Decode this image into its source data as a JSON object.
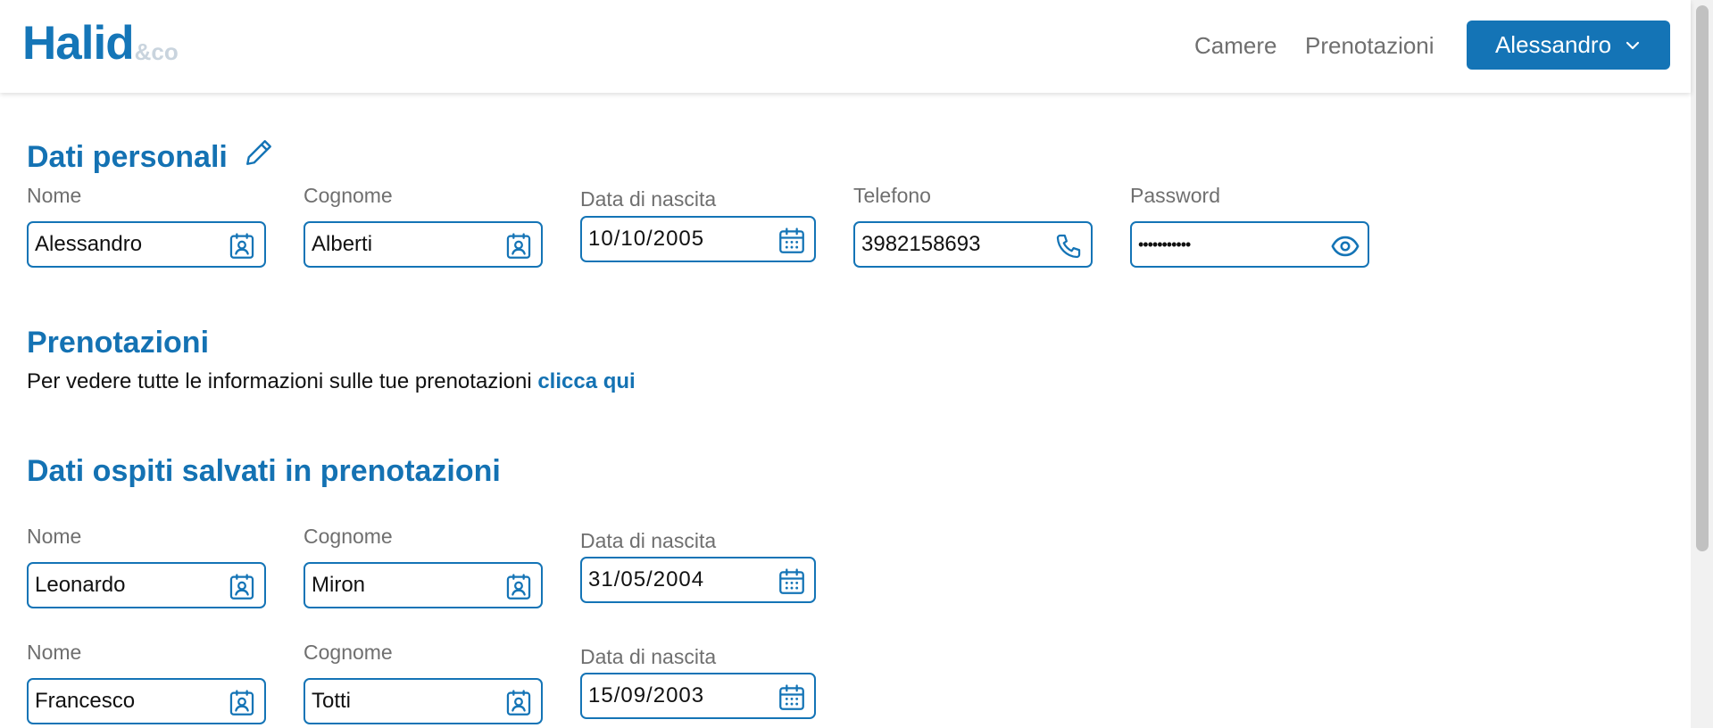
{
  "header": {
    "logo_main": "Halid",
    "logo_sub": "&co",
    "nav": [
      "Camere",
      "Prenotazioni"
    ],
    "user_label": "Alessandro"
  },
  "personal": {
    "title": "Dati personali",
    "labels": {
      "nome": "Nome",
      "cognome": "Cognome",
      "data": "Data di nascita",
      "telefono": "Telefono",
      "password": "Password"
    },
    "values": {
      "nome": "Alessandro",
      "cognome": "Alberti",
      "data": "10/10/2005",
      "telefono": "3982158693",
      "password": "•••••••••••"
    }
  },
  "bookings": {
    "title": "Prenotazioni",
    "text": "Per vedere tutte le informazioni sulle tue prenotazioni ",
    "link": "clicca qui"
  },
  "guests": {
    "title": "Dati ospiti salvati in prenotazioni",
    "labels": {
      "nome": "Nome",
      "cognome": "Cognome",
      "data": "Data di nascita"
    },
    "rows": [
      {
        "nome": "Leonardo",
        "cognome": "Miron",
        "data": "31/05/2004"
      },
      {
        "nome": "Francesco",
        "cognome": "Totti",
        "data": "15/09/2003"
      }
    ]
  },
  "colors": {
    "primary": "#1474b6",
    "title": "#1472b3",
    "label": "#6f6f6f",
    "logo_sub": "#c9d4de"
  },
  "icons": [
    "pencil-icon",
    "contact-card-icon",
    "calendar-icon",
    "phone-icon",
    "eye-icon",
    "chevron-down-icon"
  ]
}
